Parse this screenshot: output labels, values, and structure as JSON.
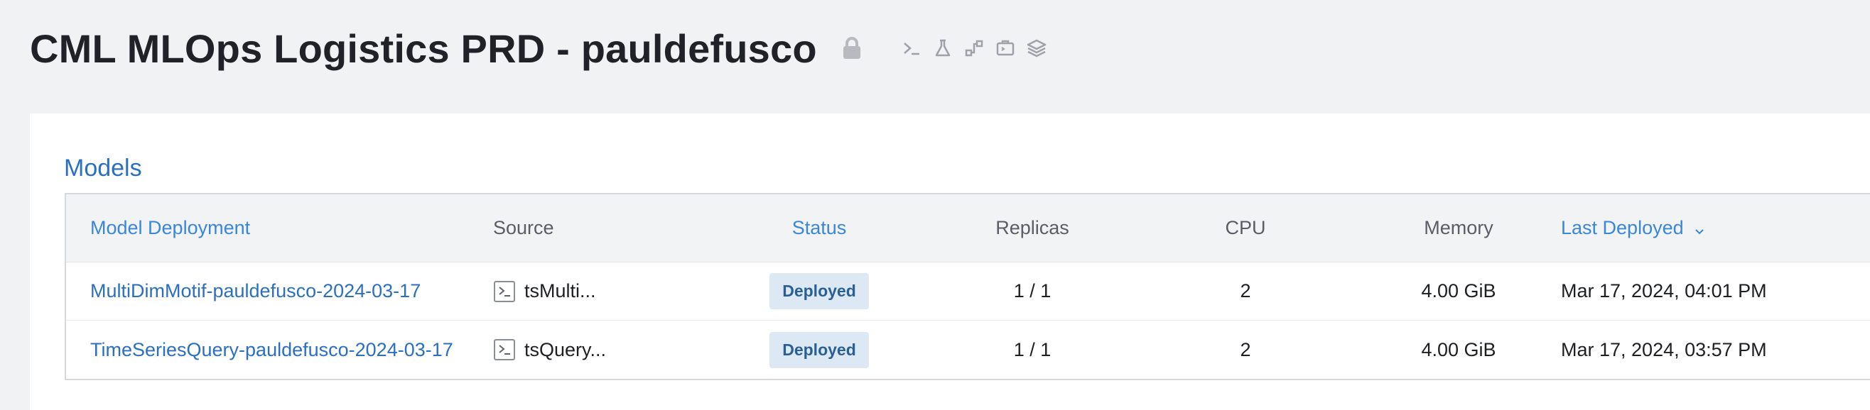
{
  "project": {
    "title": "CML MLOps Logistics PRD - pauldefusco",
    "icons": [
      "lock-icon",
      "terminal-icon",
      "flask-icon",
      "workflow-icon",
      "jobs-icon",
      "layers-icon"
    ]
  },
  "models": {
    "section_title": "Models",
    "columns": {
      "deployment": "Model Deployment",
      "source": "Source",
      "status": "Status",
      "replicas": "Replicas",
      "cpu": "CPU",
      "memory": "Memory",
      "last_deployed": "Last Deployed"
    },
    "rows": [
      {
        "deployment": "MultiDimMotif-pauldefusco-2024-03-17",
        "source": "tsMulti...",
        "status": "Deployed",
        "replicas": "1 / 1",
        "cpu": "2",
        "memory": "4.00 GiB",
        "last_deployed": "Mar 17, 2024, 04:01 PM"
      },
      {
        "deployment": "TimeSeriesQuery-pauldefusco-2024-03-17",
        "source": "tsQuery...",
        "status": "Deployed",
        "replicas": "1 / 1",
        "cpu": "2",
        "memory": "4.00 GiB",
        "last_deployed": "Mar 17, 2024, 03:57 PM"
      }
    ]
  },
  "colors": {
    "link": "#2b6fc4",
    "badge_bg": "#dce8f4",
    "badge_text": "#2a5f94",
    "page_bg": "#f1f2f4"
  }
}
